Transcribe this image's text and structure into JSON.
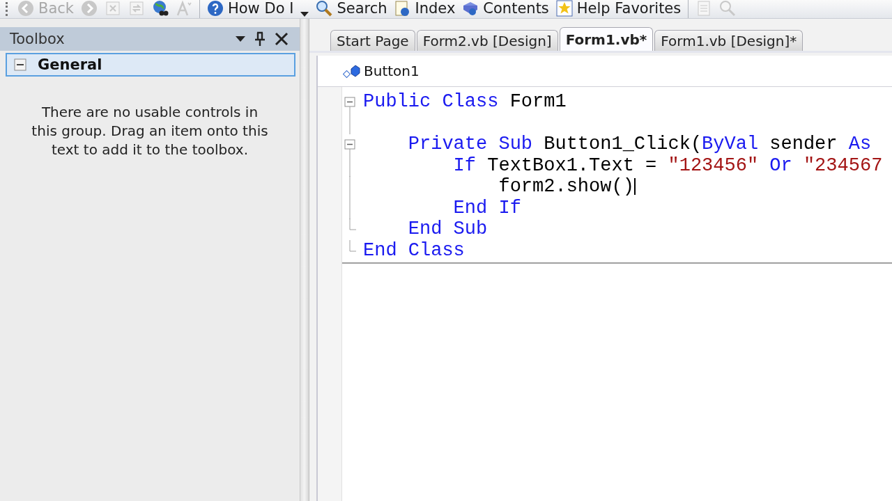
{
  "toolbar": {
    "items": [
      {
        "kind": "icon-button",
        "label": "Back",
        "disabled": true
      },
      {
        "kind": "icon-button",
        "disabled": true
      },
      {
        "kind": "icon-button",
        "disabled": true
      },
      {
        "kind": "icon-button",
        "disabled": true
      },
      {
        "kind": "icon-button",
        "disabled": false
      },
      {
        "kind": "icon-button",
        "disabled": true
      },
      {
        "kind": "separator"
      },
      {
        "kind": "icon-button",
        "label": "How Do I",
        "disabled": false
      },
      {
        "kind": "dropdown"
      },
      {
        "kind": "icon-button",
        "label": "Search",
        "disabled": false
      },
      {
        "kind": "icon-button",
        "label": "Index",
        "disabled": false
      },
      {
        "kind": "icon-button",
        "label": "Contents",
        "disabled": false
      },
      {
        "kind": "icon-button",
        "label": "Help Favorites",
        "disabled": false
      },
      {
        "kind": "separator"
      },
      {
        "kind": "icon-button",
        "disabled": true
      },
      {
        "kind": "icon-button",
        "disabled": true
      }
    ]
  },
  "toolbox": {
    "title": "Toolbox",
    "group": {
      "label": "General",
      "expanded": true,
      "selected": true
    },
    "message": "There are no usable controls in this group. Drag an item onto this text to add it to the toolbox."
  },
  "tabs": [
    {
      "label": "Start Page",
      "selected": false
    },
    {
      "label": "Form2.vb [Design]",
      "selected": false
    },
    {
      "label": "Form1.vb*",
      "selected": true
    },
    {
      "label": "Form1.vb [Design]*",
      "selected": false
    }
  ],
  "editor": {
    "object": "Button1",
    "blocks": [
      {
        "kind": "block",
        "header": [
          {
            "kind": "keyword",
            "text": "Public Class "
          },
          {
            "kind": "plain",
            "text": "Form1"
          }
        ],
        "children": [
          {
            "kind": "blank"
          },
          {
            "kind": "block",
            "header": [
              {
                "kind": "keyword",
                "text": "    Private Sub "
              },
              {
                "kind": "plain",
                "text": "Button1_Click("
              },
              {
                "kind": "keyword",
                "text": "ByVal "
              },
              {
                "kind": "plain",
                "text": "sender "
              },
              {
                "kind": "keyword",
                "text": "As"
              }
            ],
            "children": [
              {
                "kind": "line",
                "tokens": [
                  {
                    "kind": "keyword",
                    "text": "        If "
                  },
                  {
                    "kind": "plain",
                    "text": "TextBox1.Text = "
                  },
                  {
                    "kind": "string",
                    "text": "\"123456\" "
                  },
                  {
                    "kind": "keyword",
                    "text": "Or "
                  },
                  {
                    "kind": "string",
                    "text": "\"234567"
                  }
                ]
              },
              {
                "kind": "line",
                "caret": true,
                "tokens": [
                  {
                    "kind": "plain",
                    "text": "            form2.show()"
                  }
                ]
              },
              {
                "kind": "line",
                "tokens": [
                  {
                    "kind": "keyword",
                    "text": "        End If"
                  }
                ]
              }
            ],
            "footer": [
              {
                "kind": "keyword",
                "text": "    End Sub"
              }
            ]
          }
        ],
        "footer": [
          {
            "kind": "keyword",
            "text": "End Class"
          }
        ]
      }
    ]
  }
}
